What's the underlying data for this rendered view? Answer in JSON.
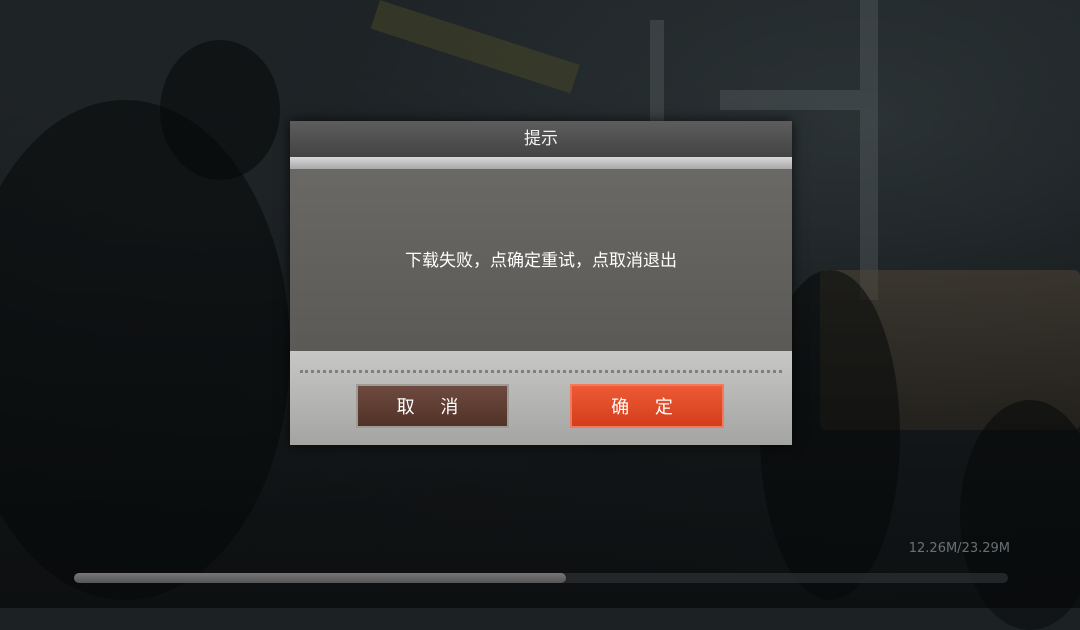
{
  "dialog": {
    "title": "提示",
    "message": "下载失败，点确定重试，点取消退出",
    "cancel_label": "取 消",
    "confirm_label": "确 定"
  },
  "download": {
    "size_text": "12.26M/23.29M",
    "progress_fraction": 0.5264
  },
  "colors": {
    "confirm_button": "#e4492a",
    "cancel_button": "#5f3e34",
    "dialog_body": "#63615d"
  }
}
